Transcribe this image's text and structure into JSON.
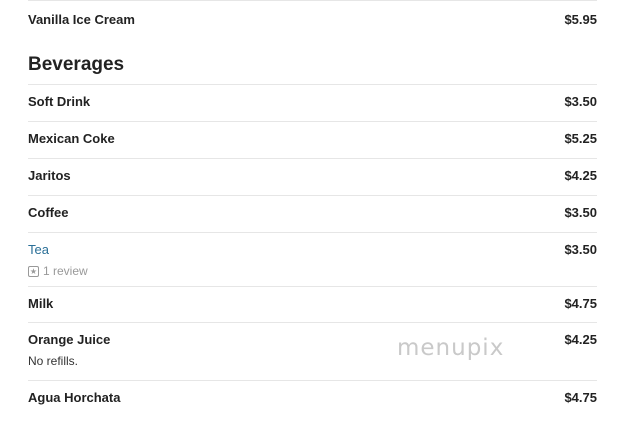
{
  "menu": {
    "top_item": {
      "name": "Vanilla Ice Cream",
      "price": "$5.95"
    },
    "section_title": "Beverages",
    "items": [
      {
        "name": "Soft Drink",
        "price": "$3.50"
      },
      {
        "name": "Mexican Coke",
        "price": "$5.25"
      },
      {
        "name": "Jaritos",
        "price": "$4.25"
      },
      {
        "name": "Coffee",
        "price": "$3.50"
      },
      {
        "name": "Tea",
        "price": "$3.50",
        "review": "1 review"
      },
      {
        "name": "Milk",
        "price": "$4.75"
      },
      {
        "name": "Orange Juice",
        "price": "$4.25",
        "description": "No refills."
      },
      {
        "name": "Agua Horchata",
        "price": "$4.75"
      }
    ]
  },
  "watermark": "menupix"
}
